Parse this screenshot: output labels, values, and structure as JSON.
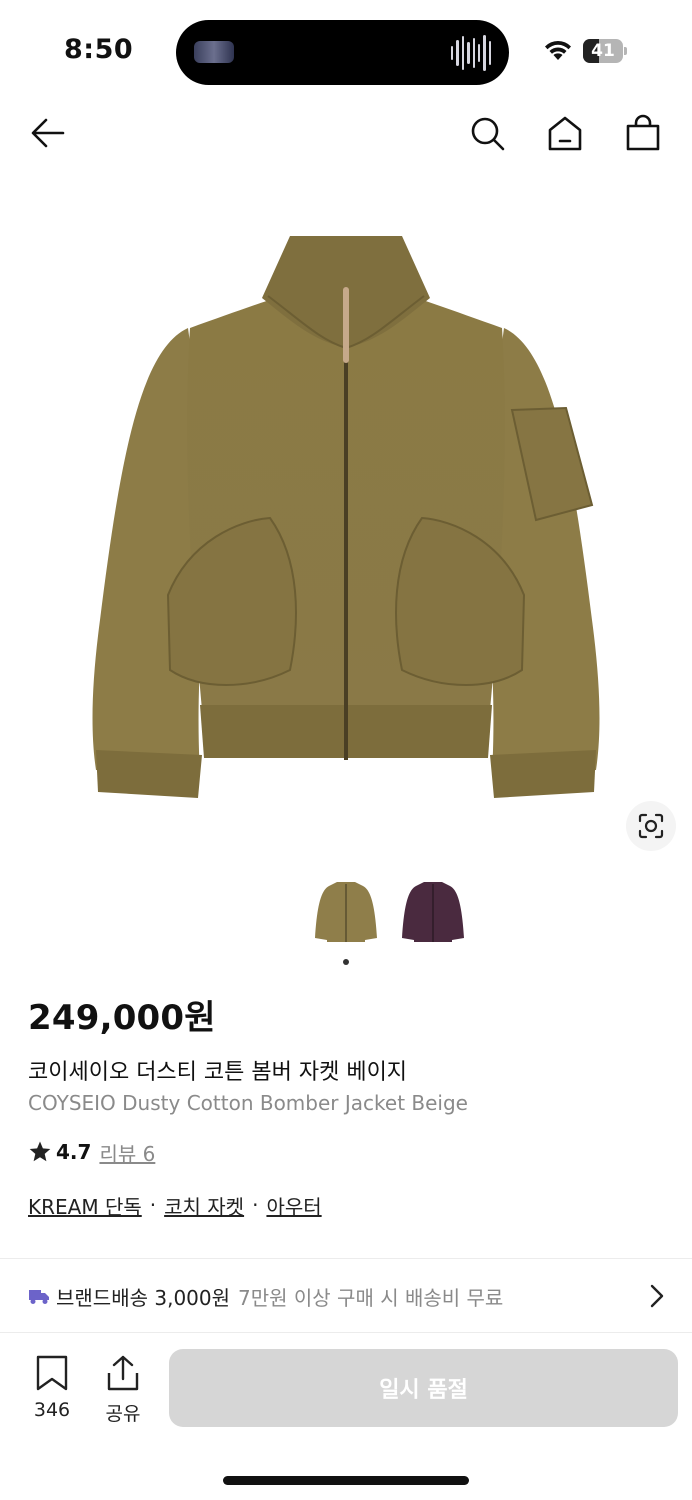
{
  "status": {
    "time": "8:50",
    "battery_level": "41",
    "battery_fraction": 0.41
  },
  "nav": {
    "back_icon": "arrow-left-icon",
    "search_icon": "search-icon",
    "home_icon": "home-icon",
    "cart_icon": "shopping-bag-icon"
  },
  "product": {
    "price": "249,000원",
    "name_ko": "코이세이오 더스티 코튼 봄버 자켓 베이지",
    "name_en": "COYSEIO Dusty Cotton Bomber Jacket Beige",
    "rating": "4.7",
    "review_label": "리뷰 6",
    "tags": [
      "KREAM 단독",
      "코치 자켓",
      "아우터"
    ],
    "tag_separator": "·",
    "colors": {
      "beige": "#8f7e4a",
      "purple": "#4a2a3f"
    }
  },
  "image": {
    "thumbnails": [
      "beige-jacket-thumbnail",
      "purple-jacket-thumbnail"
    ],
    "selected_index": 0,
    "lens_icon": "visual-search-icon"
  },
  "shipping": {
    "icon": "truck-icon",
    "label": "브랜드배송 3,000원",
    "note": "7만원 이상 구매 시 배송비 무료"
  },
  "bottom": {
    "wishlist_count": "346",
    "share_label": "공유",
    "cta_label": "일시 품절"
  },
  "theme": {
    "accent_truck": "#6c63c9",
    "button_disabled": "#d6d6d6"
  }
}
